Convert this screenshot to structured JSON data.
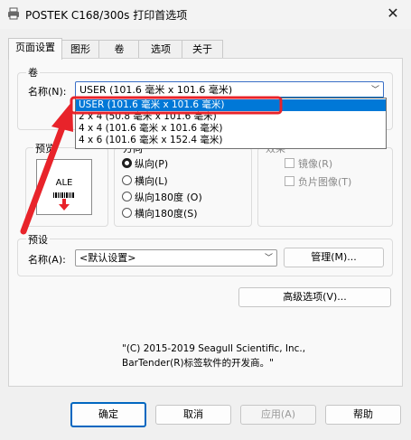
{
  "window": {
    "title": "POSTEK C168/300s 打印首选项",
    "close_glyph": "✕"
  },
  "tabs": [
    {
      "label": "页面设置",
      "active": true
    },
    {
      "label": "图形"
    },
    {
      "label": "卷"
    },
    {
      "label": "选项"
    },
    {
      "label": "关于"
    }
  ],
  "stock": {
    "group_label": "卷",
    "name_label": "名称(N):",
    "selected_value": "USER (101.6 毫米 x 101.6 毫米)",
    "options": [
      "USER (101.6 毫米 x 101.6 毫米)",
      "2 x 4 (50.8 毫米 x 101.6 毫米)",
      "4 x 4 (101.6 毫米 x 101.6 毫米)",
      "4 x 6 (101.6 毫米 x 152.4 毫米)"
    ]
  },
  "preview": {
    "group_label": "预览",
    "label_text": "ALE"
  },
  "orientation": {
    "group_label": "方向",
    "options": [
      {
        "label": "纵向(P)",
        "checked": true
      },
      {
        "label": "横向(L)",
        "checked": false
      },
      {
        "label": "纵向180度 (O)",
        "checked": false
      },
      {
        "label": "横向180度(S)",
        "checked": false
      }
    ]
  },
  "effects": {
    "group_label": "效果",
    "options": [
      {
        "label": "镜像(R)",
        "checked": false
      },
      {
        "label": "负片图像(T)",
        "checked": false
      }
    ]
  },
  "presets": {
    "group_label": "预设",
    "name_label": "名称(A):",
    "selected_value": "<默认设置>",
    "manage_label": "管理(M)..."
  },
  "advanced_label": "高级选项(V)...",
  "copyright": {
    "line1": "\"(C) 2015-2019 Seagull Scientific, Inc.,",
    "line2": "BarTender(R)标签软件的开发商。\""
  },
  "footer": {
    "ok": "确定",
    "cancel": "取消",
    "apply": "应用(A)",
    "help": "帮助"
  },
  "colors": {
    "accent": "#0067c0",
    "highlight": "#0078d7",
    "annotation_red": "#e8232a"
  }
}
